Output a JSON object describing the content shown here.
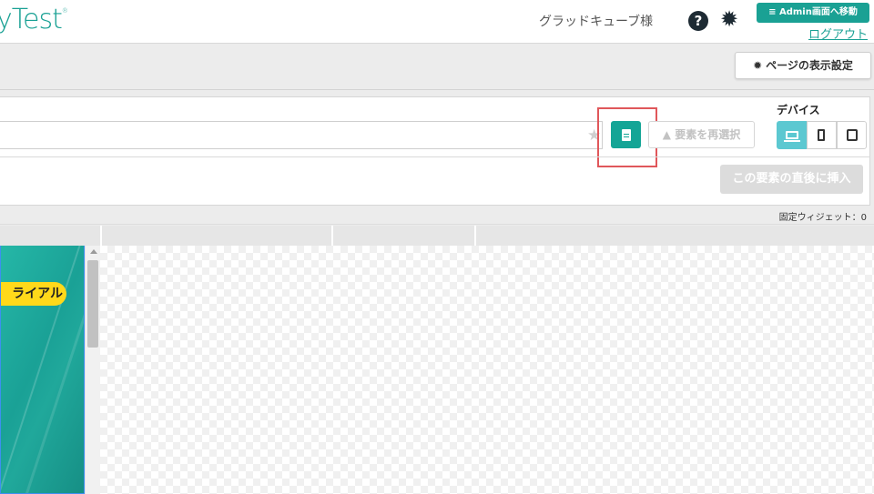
{
  "header": {
    "logo_text": "yTest",
    "logo_mark": "®",
    "user_name": "グラッドキューブ様",
    "help_symbol": "?",
    "gear_symbol": "✹",
    "admin_label": "≡ Admin画面へ移動",
    "logout_label": "ログアウト"
  },
  "subbar": {
    "page_settings_label": "ページの表示設定",
    "page_settings_icon": "gear-icon"
  },
  "toolbar": {
    "selector_value": "",
    "star_symbol": "★",
    "page_icon": "document-icon",
    "reselect_label": "▲ 要素を再選択",
    "device_label": "デバイス",
    "devices": [
      {
        "name": "pc",
        "icon": "laptop-icon",
        "active": true
      },
      {
        "name": "smartphone",
        "icon": "smartphone-icon",
        "active": false
      },
      {
        "name": "tablet",
        "icon": "tablet-icon",
        "active": false
      }
    ],
    "insert_label": "この要素の直後に挿入"
  },
  "widget_bar": {
    "fixed_widget_text": "固定ウィジェット：0"
  },
  "preview": {
    "trial_label": "ライアル"
  },
  "colors": {
    "accent": "#1aa194",
    "highlight": "#e0575b",
    "device_active": "#5cc8d1",
    "pill": "#ffd91a"
  }
}
